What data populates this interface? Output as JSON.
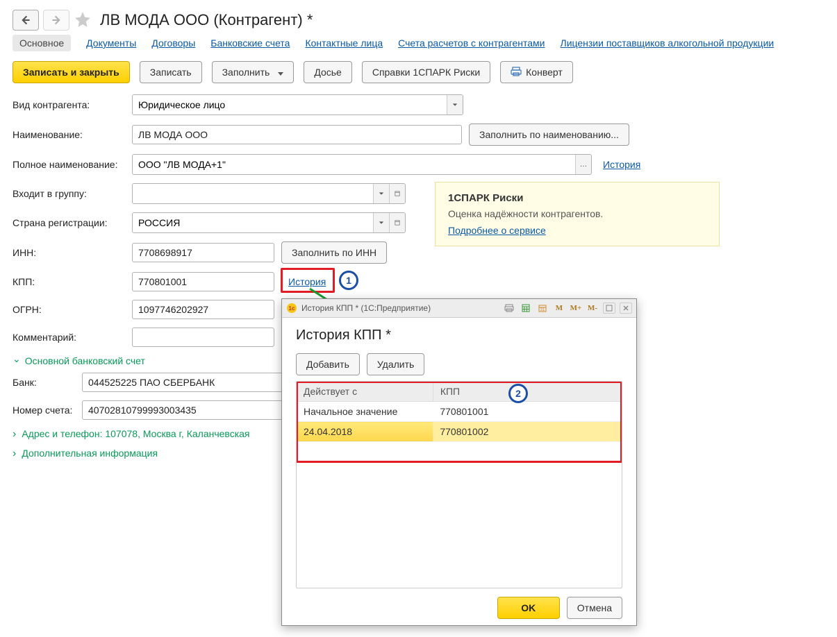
{
  "header": {
    "title": "ЛВ МОДА ООО (Контрагент) *"
  },
  "tabs": {
    "main": "Основное",
    "docs": "Документы",
    "contracts": "Договоры",
    "bank": "Банковские счета",
    "contacts": "Контактные лица",
    "accounts": "Счета расчетов с контрагентами",
    "licenses": "Лицензии поставщиков алкогольной продукции"
  },
  "actions": {
    "write_close": "Записать и закрыть",
    "write": "Записать",
    "fill": "Заполнить",
    "dossier": "Досье",
    "spark": "Справки 1СПАРК Риски",
    "convert": "Конверт"
  },
  "form": {
    "type_label": "Вид контрагента:",
    "type_value": "Юридическое лицо",
    "name_label": "Наименование:",
    "name_value": "ЛВ МОДА ООО",
    "fill_by_name": "Заполнить по наименованию...",
    "fullname_label": "Полное наименование:",
    "fullname_value": "ООО \"ЛВ МОДА+1\"",
    "history": "История",
    "group_label": "Входит в группу:",
    "group_value": "",
    "country_label": "Страна регистрации:",
    "country_value": "РОССИЯ",
    "inn_label": "ИНН:",
    "inn_value": "7708698917",
    "fill_by_inn": "Заполнить по ИНН",
    "kpp_label": "КПП:",
    "kpp_value": "770801001",
    "kpp_history": "История",
    "ogrn_label": "ОГРН:",
    "ogrn_value": "1097746202927",
    "comment_label": "Комментарий:",
    "comment_value": ""
  },
  "bank_section": {
    "title": "Основной банковский счет",
    "bank_label": "Банк:",
    "bank_value": "044525225 ПАО СБЕРБАНК",
    "acc_label": "Номер счета:",
    "acc_value": "40702810799993003435"
  },
  "expanders": {
    "addr": "Адрес и телефон: 107078, Москва г, Каланчевская",
    "extra": "Дополнительная информация"
  },
  "spark": {
    "title": "1СПАРК Риски",
    "text": "Оценка надёжности контрагентов.",
    "link": "Подробнее о сервисе"
  },
  "dialog": {
    "win_title": "История КПП * (1С:Предприятие)",
    "tb_m": "M",
    "tb_mplus": "M+",
    "tb_mminus": "M-",
    "heading": "История КПП *",
    "add": "Добавить",
    "del": "Удалить",
    "col_from": "Действует с",
    "col_kpp": "КПП",
    "rows": [
      {
        "from": "Начальное значение",
        "kpp": "770801001"
      },
      {
        "from": "24.04.2018",
        "kpp": "770801002"
      }
    ],
    "ok": "OK",
    "cancel": "Отмена"
  },
  "callouts": {
    "one": "1",
    "two": "2"
  }
}
